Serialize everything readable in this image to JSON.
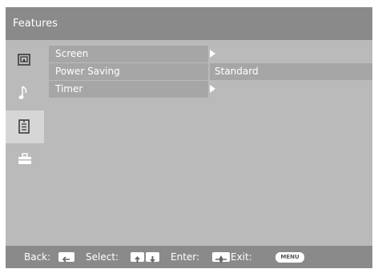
{
  "header": {
    "title": "Features"
  },
  "sidebar": {
    "items": [
      {
        "icon": "picture-icon",
        "active": false
      },
      {
        "icon": "music-note-icon",
        "active": false
      },
      {
        "icon": "features-list-icon",
        "active": true
      },
      {
        "icon": "toolbox-icon",
        "active": false
      }
    ]
  },
  "menu": {
    "rows": [
      {
        "label": "Screen",
        "value": "",
        "has_submenu": true
      },
      {
        "label": "Power Saving",
        "value": "Standard",
        "has_submenu": false
      },
      {
        "label": "Timer",
        "value": "",
        "has_submenu": true
      }
    ]
  },
  "footer": {
    "back_label": "Back:",
    "select_label": "Select:",
    "enter_label": "Enter:",
    "exit_label": "Exit:",
    "menu_key": "MENU"
  },
  "colors": {
    "title_bar": "#8a8a8a",
    "background": "#bababa",
    "row_fill": "#a6a6a6",
    "active_sidebar": "#d6d6d6",
    "text": "#ffffff"
  }
}
